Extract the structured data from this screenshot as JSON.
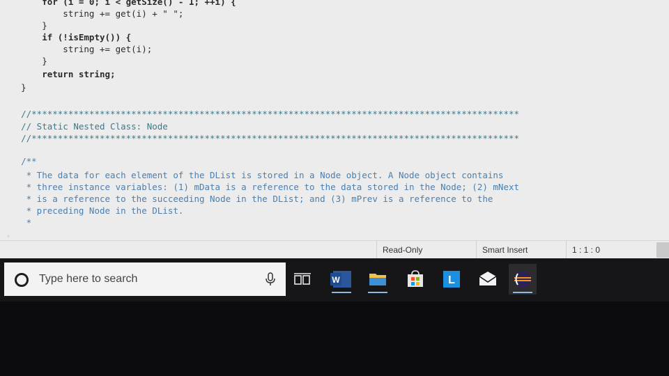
{
  "code": {
    "lines": [
      "        for (i = 0; i < getSize() - 1; ++i) {",
      "            string += get(i) + \" \";",
      "        }",
      "        if (!isEmpty()) {",
      "            string += get(i);",
      "        }",
      "        return string;",
      "    }",
      "",
      "    //*********************************************************************************************",
      "    // Static Nested Class: Node",
      "    //*********************************************************************************************",
      "",
      "    /**",
      "     * The data for each element of the DList is stored in a Node object. A Node object contains",
      "     * three instance variables: (1) mData is a reference to the data stored in the Node; (2) mNext",
      "     * is a reference to the succeeding Node in the DList; and (3) mPrev is a reference to the",
      "     * preceding Node in the DList.",
      "     *"
    ]
  },
  "statusbar": {
    "mode": "Read-Only",
    "insert_mode": "Smart Insert",
    "position": "1 : 1 : 0"
  },
  "taskbar": {
    "search_placeholder": "Type here to search",
    "apps": [
      {
        "icon": "microphone-icon"
      },
      {
        "icon": "task-view-icon"
      },
      {
        "icon": "word-icon",
        "letter": "W",
        "color": "#2b579a"
      },
      {
        "icon": "file-explorer-icon",
        "color": "#f0c24b"
      },
      {
        "icon": "store-icon",
        "color": "#e6e6e6"
      },
      {
        "icon": "lync-icon",
        "letter": "L",
        "color": "#1d8fe0"
      },
      {
        "icon": "mail-icon"
      },
      {
        "icon": "eclipse-icon",
        "color": "#2c2255"
      }
    ]
  }
}
